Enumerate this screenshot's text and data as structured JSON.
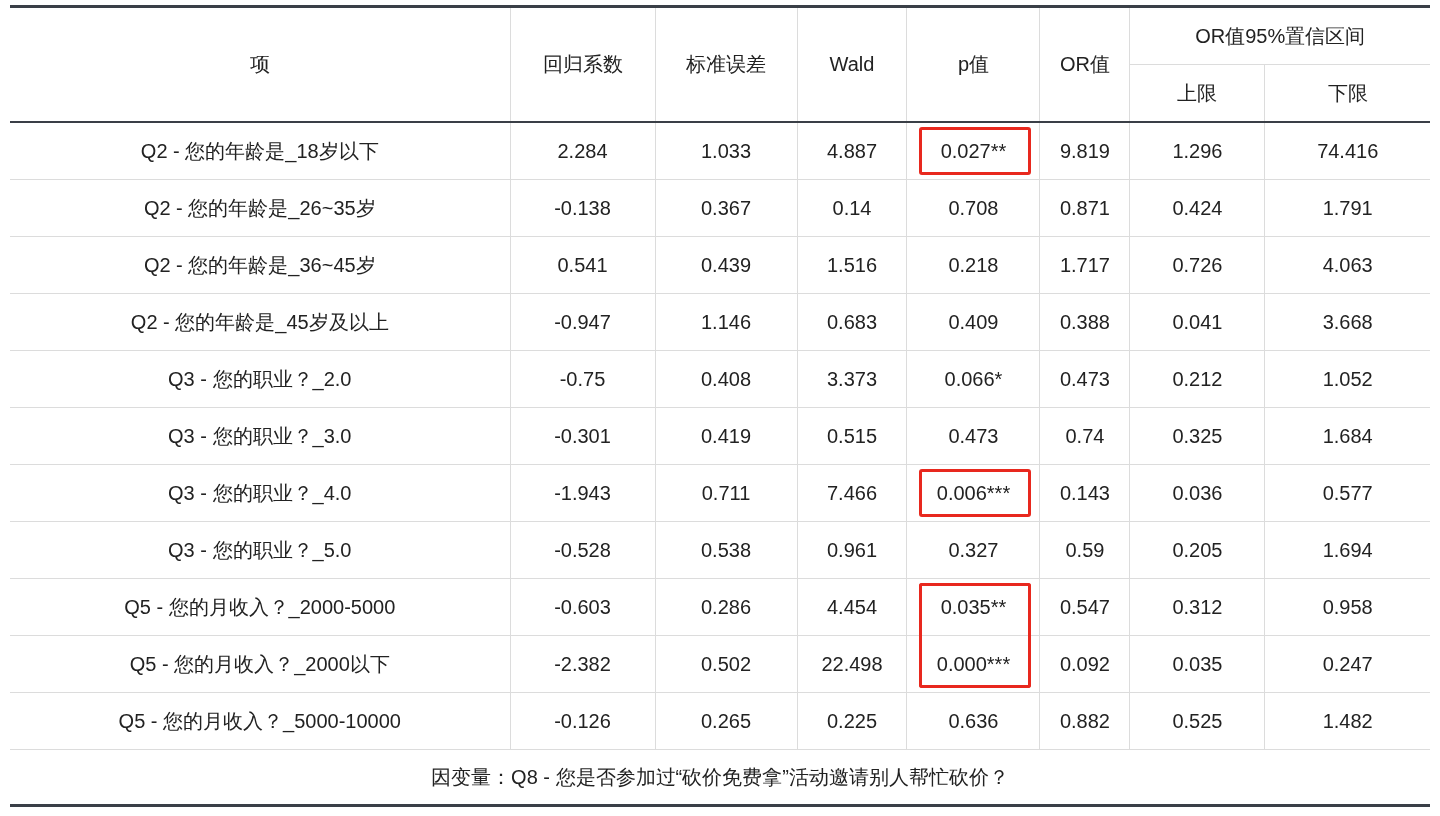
{
  "table": {
    "columns": [
      "项",
      "回归系数",
      "标准误差",
      "Wald",
      "p值",
      "OR值"
    ],
    "group_header": {
      "label": "OR值95%置信区间",
      "sub_columns": [
        "上限",
        "下限"
      ]
    },
    "rows": [
      {
        "item": "Q2 - 您的年龄是_18岁以下",
        "coef": "2.284",
        "se": "1.033",
        "wald": "4.887",
        "p": "0.027**",
        "p_highlighted": true,
        "or": "9.819",
        "upper": "1.296",
        "lower": "74.416"
      },
      {
        "item": "Q2 - 您的年龄是_26~35岁",
        "coef": "-0.138",
        "se": "0.367",
        "wald": "0.14",
        "p": "0.708",
        "p_highlighted": false,
        "or": "0.871",
        "upper": "0.424",
        "lower": "1.791"
      },
      {
        "item": "Q2 - 您的年龄是_36~45岁",
        "coef": "0.541",
        "se": "0.439",
        "wald": "1.516",
        "p": "0.218",
        "p_highlighted": false,
        "or": "1.717",
        "upper": "0.726",
        "lower": "4.063"
      },
      {
        "item": "Q2 - 您的年龄是_45岁及以上",
        "coef": "-0.947",
        "se": "1.146",
        "wald": "0.683",
        "p": "0.409",
        "p_highlighted": false,
        "or": "0.388",
        "upper": "0.041",
        "lower": "3.668"
      },
      {
        "item": "Q3 - 您的职业？_2.0",
        "coef": "-0.75",
        "se": "0.408",
        "wald": "3.373",
        "p": "0.066*",
        "p_highlighted": false,
        "or": "0.473",
        "upper": "0.212",
        "lower": "1.052"
      },
      {
        "item": "Q3 - 您的职业？_3.0",
        "coef": "-0.301",
        "se": "0.419",
        "wald": "0.515",
        "p": "0.473",
        "p_highlighted": false,
        "or": "0.74",
        "upper": "0.325",
        "lower": "1.684"
      },
      {
        "item": "Q3 - 您的职业？_4.0",
        "coef": "-1.943",
        "se": "0.711",
        "wald": "7.466",
        "p": "0.006***",
        "p_highlighted": true,
        "or": "0.143",
        "upper": "0.036",
        "lower": "0.577"
      },
      {
        "item": "Q3 - 您的职业？_5.0",
        "coef": "-0.528",
        "se": "0.538",
        "wald": "0.961",
        "p": "0.327",
        "p_highlighted": false,
        "or": "0.59",
        "upper": "0.205",
        "lower": "1.694"
      },
      {
        "item": "Q5 - 您的月收入？_2000-5000",
        "coef": "-0.603",
        "se": "0.286",
        "wald": "4.454",
        "p": "0.035**",
        "p_highlighted": true,
        "or": "0.547",
        "upper": "0.312",
        "lower": "0.958"
      },
      {
        "item": "Q5 - 您的月收入？_2000以下",
        "coef": "-2.382",
        "se": "0.502",
        "wald": "22.498",
        "p": "0.000***",
        "p_highlighted": true,
        "or": "0.092",
        "upper": "0.035",
        "lower": "0.247"
      },
      {
        "item": "Q5 - 您的月收入？_5000-10000",
        "coef": "-0.126",
        "se": "0.265",
        "wald": "0.225",
        "p": "0.636",
        "p_highlighted": false,
        "or": "0.882",
        "upper": "0.525",
        "lower": "1.482"
      }
    ],
    "footnote": "因变量：Q8 - 您是否参加过“砍价免费拿”活动邀请别人帮忙砍价？"
  }
}
